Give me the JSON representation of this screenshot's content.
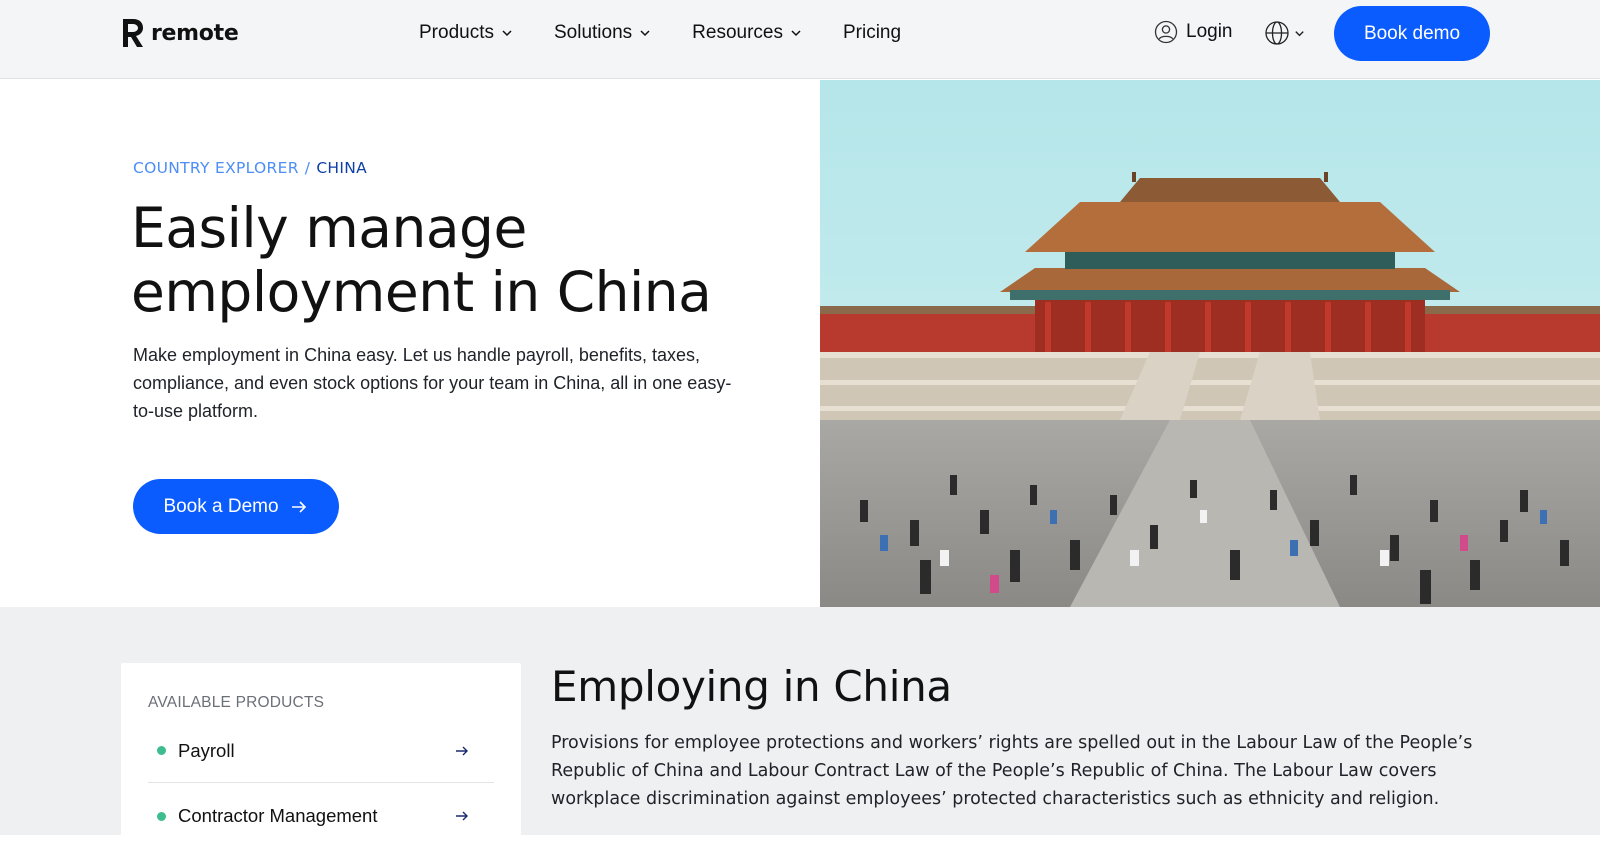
{
  "header": {
    "logo_text": "remote",
    "nav": [
      {
        "label": "Products",
        "has_dropdown": true
      },
      {
        "label": "Solutions",
        "has_dropdown": true
      },
      {
        "label": "Resources",
        "has_dropdown": true
      },
      {
        "label": "Pricing",
        "has_dropdown": false
      }
    ],
    "login_label": "Login",
    "language_icon": "globe-icon",
    "book_demo_label": "Book demo"
  },
  "hero": {
    "breadcrumb": {
      "parent": "COUNTRY EXPLORER",
      "separator": "/",
      "current": "CHINA"
    },
    "title": "Easily manage employment in China",
    "description": "Make employment in China easy. Let us handle payroll, benefits, taxes, compliance, and even stock options for your team in China, all in one easy-to-use platform.",
    "cta_label": "Book a Demo"
  },
  "products_card": {
    "heading": "AVAILABLE PRODUCTS",
    "items": [
      {
        "label": "Payroll"
      },
      {
        "label": "Contractor Management"
      }
    ]
  },
  "employing": {
    "title": "Employing in China",
    "body": "Provisions for employee protections and workers’ rights are spelled out in the Labour Law of the People’s Republic of China and Labour Contract Law of the People’s Republic of China. The Labour Law covers workplace discrimination against employees’ protected characteristics such as ethnicity and religion."
  },
  "colors": {
    "accent": "#0b5cff",
    "breadcrumb_link": "#4c8df6",
    "breadcrumb_current": "#0f3fa8",
    "product_dot": "#3dbd8e",
    "header_bg": "#f4f5f7",
    "lower_bg": "#eef0f1"
  }
}
